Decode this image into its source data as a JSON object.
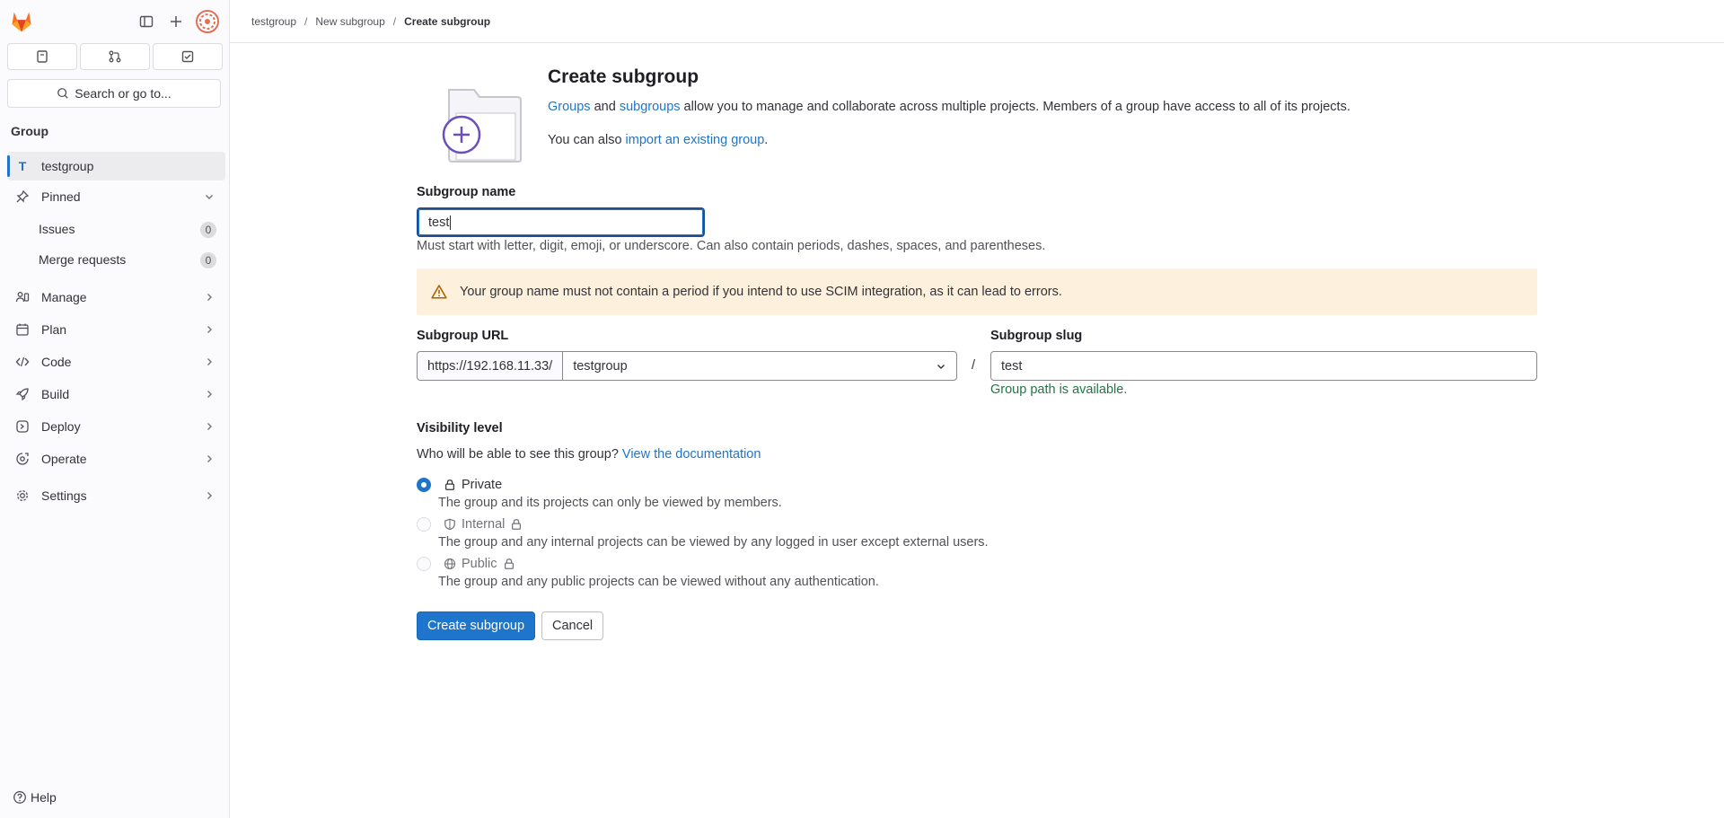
{
  "sidebar": {
    "search_label": "Search or go to...",
    "section_title": "Group",
    "group_badge": "T",
    "group_name": "testgroup",
    "pinned_label": "Pinned",
    "pinned_items": [
      {
        "label": "Issues",
        "count": "0"
      },
      {
        "label": "Merge requests",
        "count": "0"
      }
    ],
    "menu": [
      {
        "label": "Manage",
        "icon": "manage-icon"
      },
      {
        "label": "Plan",
        "icon": "plan-icon"
      },
      {
        "label": "Code",
        "icon": "code-icon"
      },
      {
        "label": "Build",
        "icon": "rocket-icon"
      },
      {
        "label": "Deploy",
        "icon": "deploy-icon"
      },
      {
        "label": "Operate",
        "icon": "operate-icon"
      },
      {
        "label": "Settings",
        "icon": "gear-icon"
      }
    ],
    "help_label": "Help"
  },
  "breadcrumb": [
    "testgroup",
    "New subgroup",
    "Create subgroup"
  ],
  "page": {
    "title": "Create subgroup",
    "desc_link1": "Groups",
    "desc_and": " and ",
    "desc_link2": "subgroups",
    "desc_rest": " allow you to manage and collaborate across multiple projects. Members of a group have access to all of its projects.",
    "import_prefix": "You can also ",
    "import_link": "import an existing group",
    "import_suffix": "."
  },
  "form": {
    "name_label": "Subgroup name",
    "name_value": "test",
    "name_hint": "Must start with letter, digit, emoji, or underscore. Can also contain periods, dashes, spaces, and parentheses.",
    "alert_text": "Your group name must not contain a period if you intend to use SCIM integration, as it can lead to errors.",
    "url_label": "Subgroup URL",
    "url_prefix": "https://192.168.11.33/",
    "url_parent": "testgroup",
    "slash": "/",
    "slug_label": "Subgroup slug",
    "slug_value": "test",
    "slug_status": "Group path is available.",
    "visibility_label": "Visibility level",
    "visibility_question": "Who will be able to see this group?",
    "visibility_doc_link": "View the documentation",
    "visibility_options": [
      {
        "label": "Private",
        "desc": "The group and its projects can only be viewed by members.",
        "checked": true,
        "disabled": false
      },
      {
        "label": "Internal",
        "desc": "The group and any internal projects can be viewed by any logged in user except external users.",
        "checked": false,
        "disabled": true
      },
      {
        "label": "Public",
        "desc": "The group and any public projects can be viewed without any authentication.",
        "checked": false,
        "disabled": true
      }
    ],
    "submit_label": "Create subgroup",
    "cancel_label": "Cancel"
  },
  "colors": {
    "accent": "#1f75cb",
    "success": "#217645",
    "warning_bg": "#fdf1dd",
    "brand": "#e24329"
  }
}
